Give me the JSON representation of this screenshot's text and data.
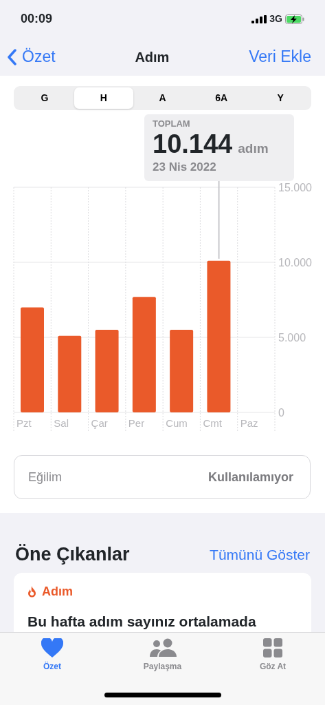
{
  "status_bar": {
    "time": "00:09",
    "network": "3G",
    "charging": true
  },
  "nav": {
    "back": "Özet",
    "title": "Adım",
    "action": "Veri Ekle"
  },
  "segments": [
    {
      "label": "G",
      "selected": false
    },
    {
      "label": "H",
      "selected": true
    },
    {
      "label": "A",
      "selected": false
    },
    {
      "label": "6A",
      "selected": false
    },
    {
      "label": "Y",
      "selected": false
    }
  ],
  "tooltip": {
    "label": "TOPLAM",
    "value": "10.144",
    "unit": "adım",
    "date": "23 Nis 2022"
  },
  "chart_data": {
    "type": "bar",
    "categories": [
      "Pzt",
      "Sal",
      "Çar",
      "Per",
      "Cum",
      "Cmt",
      "Paz"
    ],
    "series": [
      {
        "color": "#ea5a2a",
        "values": [
          7000,
          5100,
          5500,
          7700,
          5500,
          10100,
          null
        ]
      }
    ],
    "ylim": [
      0,
      15000
    ],
    "yticks": [
      {
        "value": 0,
        "label": "0"
      },
      {
        "value": 5000,
        "label": "5.000"
      },
      {
        "value": 10000,
        "label": "10.000"
      },
      {
        "value": 15000,
        "label": "15.000"
      }
    ]
  },
  "trend": {
    "label": "Eğilim",
    "value": "Kullanılamıyor"
  },
  "highlights": {
    "title": "Öne Çıkanlar",
    "action": "Tümünü Göster",
    "card": {
      "category": "Adım",
      "text": "Bu hafta adım sayınız ortalamada"
    }
  },
  "tab_bar": [
    {
      "kind": "heart",
      "label": "Özet",
      "selected": true
    },
    {
      "kind": "people",
      "label": "Paylaşma",
      "selected": false
    },
    {
      "kind": "grid",
      "label": "Göz At",
      "selected": false
    }
  ]
}
